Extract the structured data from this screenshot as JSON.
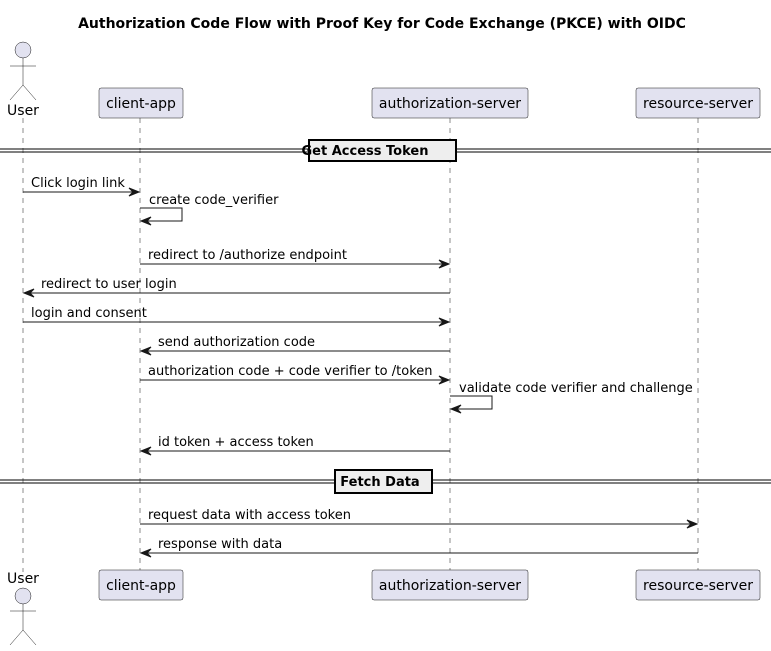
{
  "diagram": {
    "title": "Authorization Code Flow with Proof Key for Code Exchange (PKCE) with OIDC",
    "participants": [
      {
        "id": "user",
        "label": "User",
        "type": "actor"
      },
      {
        "id": "client",
        "label": "client-app",
        "type": "participant"
      },
      {
        "id": "auth",
        "label": "authorization-server",
        "type": "participant"
      },
      {
        "id": "resource",
        "label": "resource-server",
        "type": "participant"
      }
    ],
    "dividers": [
      {
        "label": "Get Access Token"
      },
      {
        "label": "Fetch Data"
      }
    ],
    "messages": [
      {
        "from": "user",
        "to": "client",
        "label": "Click login link"
      },
      {
        "from": "client",
        "to": "client",
        "label": "create code_verifier"
      },
      {
        "from": "client",
        "to": "auth",
        "label": "redirect to /authorize endpoint"
      },
      {
        "from": "auth",
        "to": "user",
        "label": "redirect to user login"
      },
      {
        "from": "user",
        "to": "auth",
        "label": "login and consent"
      },
      {
        "from": "auth",
        "to": "client",
        "label": "send authorization code"
      },
      {
        "from": "client",
        "to": "auth",
        "label": "authorization code + code verifier to /token"
      },
      {
        "from": "auth",
        "to": "auth",
        "label": "validate code verifier and challenge"
      },
      {
        "from": "auth",
        "to": "client",
        "label": "id token + access token"
      },
      {
        "from": "client",
        "to": "resource",
        "label": "request data with access token"
      },
      {
        "from": "resource",
        "to": "client",
        "label": "response with data"
      }
    ],
    "colors": {
      "participant_fill": "#E2E2F0",
      "divider_fill": "#EEEEEE",
      "line": "#181818"
    }
  }
}
